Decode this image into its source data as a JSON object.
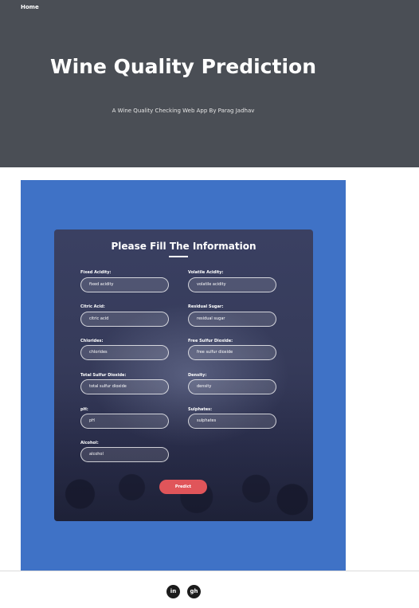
{
  "nav": {
    "home": "Home"
  },
  "hero": {
    "title": "Wine Quality Prediction",
    "subtitle": "A Wine Quality Checking Web App By Parag Jadhav"
  },
  "form": {
    "title": "Please Fill The Information",
    "fields": [
      {
        "label": "Fixed Acidity:",
        "placeholder": "fixed acidity"
      },
      {
        "label": "Volatile Acidity:",
        "placeholder": "volatile acidity"
      },
      {
        "label": "Citric Acid:",
        "placeholder": "citric acid"
      },
      {
        "label": "Residual Sugar:",
        "placeholder": "residual sugar"
      },
      {
        "label": "Chlorides:",
        "placeholder": "chlorides"
      },
      {
        "label": "Free Sulfur Dioxide:",
        "placeholder": "free sulfur dioxide"
      },
      {
        "label": "Total Sulfur Dioxide:",
        "placeholder": "total sulfur dioxide"
      },
      {
        "label": "Density:",
        "placeholder": "density"
      },
      {
        "label": "pH:",
        "placeholder": "pH"
      },
      {
        "label": "Sulphates:",
        "placeholder": "sulphates"
      },
      {
        "label": "Alcohol:",
        "placeholder": "alcohol"
      }
    ],
    "submit": "Predict"
  },
  "footer": {
    "icons": [
      {
        "name": "linkedin-icon",
        "glyph": "in"
      },
      {
        "name": "github-icon",
        "glyph": "gh"
      }
    ]
  },
  "colors": {
    "hero_bg": "#4a4e55",
    "panel_bg": "#3f72c6",
    "card_bg": "#363b5a",
    "button": "#e0555a"
  }
}
